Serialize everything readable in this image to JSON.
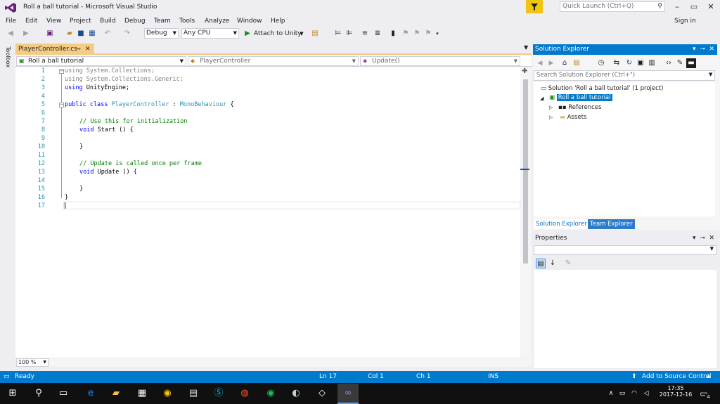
{
  "window": {
    "title": "Roll a ball tutorial - Microsoft Visual Studio",
    "quick_launch_placeholder": "Quick Launch (Ctrl+Q)",
    "sign_in": "Sign in",
    "controls": [
      "–",
      "▭",
      "✕"
    ]
  },
  "menu": [
    "File",
    "Edit",
    "View",
    "Project",
    "Build",
    "Debug",
    "Team",
    "Tools",
    "Analyze",
    "Window",
    "Help"
  ],
  "toolbar": {
    "config": "Debug",
    "platform": "Any CPU",
    "attach_label": "Attach to Unity"
  },
  "toolbox_label": "Toolbox",
  "editor": {
    "tab_name": "PlayerController.cs",
    "nav_project": "Roll a ball tutorial",
    "nav_class": "PlayerController",
    "nav_member": "Update()",
    "line_numbers": [
      "1",
      "2",
      "3",
      "4",
      "5",
      "6",
      "7",
      "8",
      "9",
      "10",
      "11",
      "12",
      "13",
      "14",
      "15",
      "16",
      "17"
    ],
    "lines": {
      "l1_kw": "using",
      "l1_rest": " System.Collections;",
      "l2_kw": "using",
      "l2_rest": " System.Collections.Generic;",
      "l3_kw": "using",
      "l3_rest": " UnityEngine;",
      "l5_kw": "public class",
      "l5_sp": " ",
      "l5_type": "PlayerController",
      "l5_mid": " : ",
      "l5_base": "MonoBehaviour",
      "l5_end": " {",
      "l7": "// Use this for initialization",
      "l8_kw": "void",
      "l8_rest": " Start () {",
      "l10": "}",
      "l12": "// Update is called once per frame",
      "l13_kw": "void",
      "l13_rest": " Update () {",
      "l15": "}",
      "l16": "}"
    },
    "zoom": "100 %"
  },
  "solution_explorer": {
    "title": "Solution Explorer",
    "search_placeholder": "Search Solution Explorer (Ctrl+\")",
    "solution": "Solution 'Roll a ball tutorial' (1 project)",
    "project": "Roll a ball tutorial",
    "references": "References",
    "assets": "Assets",
    "tab_se": "Solution Explorer",
    "tab_te": "Team Explorer"
  },
  "properties": {
    "title": "Properties"
  },
  "status": {
    "ready": "Ready",
    "ln": "Ln 17",
    "col": "Col 1",
    "ch": "Ch 1",
    "ins": "INS",
    "source_control": "Add to Source Control"
  },
  "taskbar": {
    "time": "17:35",
    "date": "2017-12-16",
    "notifications": "4"
  },
  "colors": {
    "accent": "#007acc",
    "tab_active": "#f5cc84",
    "keyword": "#0000ff",
    "type": "#2b91af",
    "comment": "#008000"
  }
}
